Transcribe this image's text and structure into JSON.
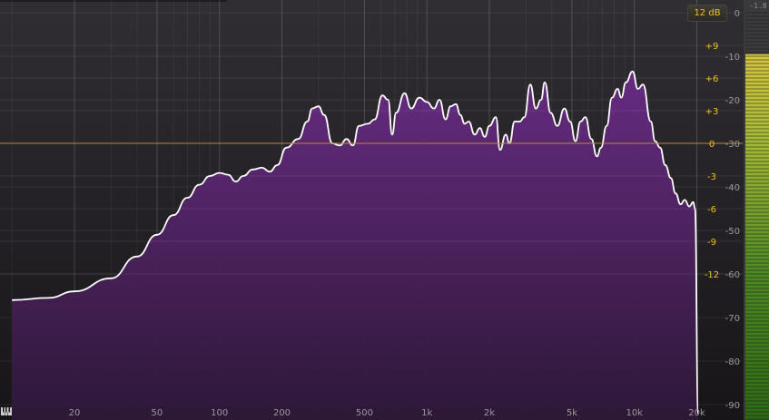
{
  "range_button": {
    "label": "12 dB"
  },
  "meter": {
    "peak_readout": "-1.8",
    "level_db": -1.8
  },
  "freq_axis": {
    "labels": [
      "20",
      "50",
      "100",
      "200",
      "500",
      "1k",
      "2k",
      "5k",
      "10k",
      "20k"
    ],
    "values": [
      20,
      50,
      100,
      200,
      500,
      1000,
      2000,
      5000,
      10000,
      20000
    ],
    "range_hz": [
      10,
      22000
    ]
  },
  "eq_axis": {
    "labels": [
      "+9",
      "+6",
      "+3",
      "0",
      "-3",
      "-6",
      "-9",
      "-12"
    ],
    "values": [
      9,
      6,
      3,
      0,
      -3,
      -6,
      -9,
      -12
    ],
    "color": "#f2c01a"
  },
  "level_axis": {
    "labels": [
      "0",
      "-10",
      "-20",
      "-30",
      "-40",
      "-50",
      "-60",
      "-70",
      "-80",
      "-90"
    ],
    "values": [
      0,
      -10,
      -20,
      -30,
      -40,
      -50,
      -60,
      -70,
      -80,
      -90
    ]
  },
  "spectrum": {
    "fill_color": "#5e2a76",
    "line_color": "#ffffff",
    "points": [
      [
        10,
        -66
      ],
      [
        15,
        -65.5
      ],
      [
        20,
        -64
      ],
      [
        30,
        -61
      ],
      [
        40,
        -56
      ],
      [
        50,
        -51
      ],
      [
        60,
        -46.5
      ],
      [
        70,
        -42.5
      ],
      [
        80,
        -39.5
      ],
      [
        90,
        -37.5
      ],
      [
        100,
        -36.8
      ],
      [
        110,
        -37.2
      ],
      [
        120,
        -38.8
      ],
      [
        130,
        -37.5
      ],
      [
        145,
        -36
      ],
      [
        160,
        -35.6
      ],
      [
        175,
        -36.5
      ],
      [
        190,
        -35
      ],
      [
        210,
        -31
      ],
      [
        240,
        -29
      ],
      [
        265,
        -25
      ],
      [
        280,
        -22
      ],
      [
        300,
        -21.5
      ],
      [
        320,
        -23.5
      ],
      [
        350,
        -30
      ],
      [
        380,
        -30.5
      ],
      [
        410,
        -29
      ],
      [
        440,
        -30.5
      ],
      [
        470,
        -26
      ],
      [
        520,
        -25.5
      ],
      [
        560,
        -24.5
      ],
      [
        610,
        -19
      ],
      [
        650,
        -20
      ],
      [
        680,
        -28
      ],
      [
        710,
        -23
      ],
      [
        780,
        -18.5
      ],
      [
        840,
        -22
      ],
      [
        920,
        -19.5
      ],
      [
        1000,
        -20.5
      ],
      [
        1080,
        -22
      ],
      [
        1150,
        -20
      ],
      [
        1230,
        -24.5
      ],
      [
        1300,
        -21.5
      ],
      [
        1380,
        -21
      ],
      [
        1450,
        -23.5
      ],
      [
        1520,
        -25.5
      ],
      [
        1590,
        -25
      ],
      [
        1700,
        -28
      ],
      [
        1800,
        -26.5
      ],
      [
        1900,
        -28.5
      ],
      [
        2000,
        -26
      ],
      [
        2150,
        -24
      ],
      [
        2250,
        -31.5
      ],
      [
        2400,
        -28
      ],
      [
        2500,
        -30
      ],
      [
        2650,
        -25
      ],
      [
        2800,
        -25
      ],
      [
        2950,
        -24
      ],
      [
        3150,
        -16.5
      ],
      [
        3350,
        -22
      ],
      [
        3550,
        -20
      ],
      [
        3700,
        -16
      ],
      [
        3950,
        -23
      ],
      [
        4250,
        -26
      ],
      [
        4600,
        -22
      ],
      [
        4900,
        -25
      ],
      [
        5200,
        -29.5
      ],
      [
        5500,
        -25
      ],
      [
        5800,
        -24
      ],
      [
        6200,
        -29
      ],
      [
        6600,
        -33
      ],
      [
        6900,
        -31
      ],
      [
        7350,
        -26
      ],
      [
        7800,
        -19.5
      ],
      [
        8300,
        -17.5
      ],
      [
        8650,
        -19.5
      ],
      [
        9100,
        -16
      ],
      [
        9800,
        -13.5
      ],
      [
        10400,
        -17.5
      ],
      [
        11000,
        -16.5
      ],
      [
        12000,
        -25
      ],
      [
        12600,
        -29.5
      ],
      [
        13300,
        -31
      ],
      [
        14100,
        -35
      ],
      [
        15000,
        -38
      ],
      [
        15800,
        -41.5
      ],
      [
        16700,
        -44
      ],
      [
        17500,
        -43
      ],
      [
        18400,
        -44.5
      ],
      [
        19200,
        -43.5
      ],
      [
        19600,
        -45
      ],
      [
        20300,
        -92
      ]
    ]
  }
}
